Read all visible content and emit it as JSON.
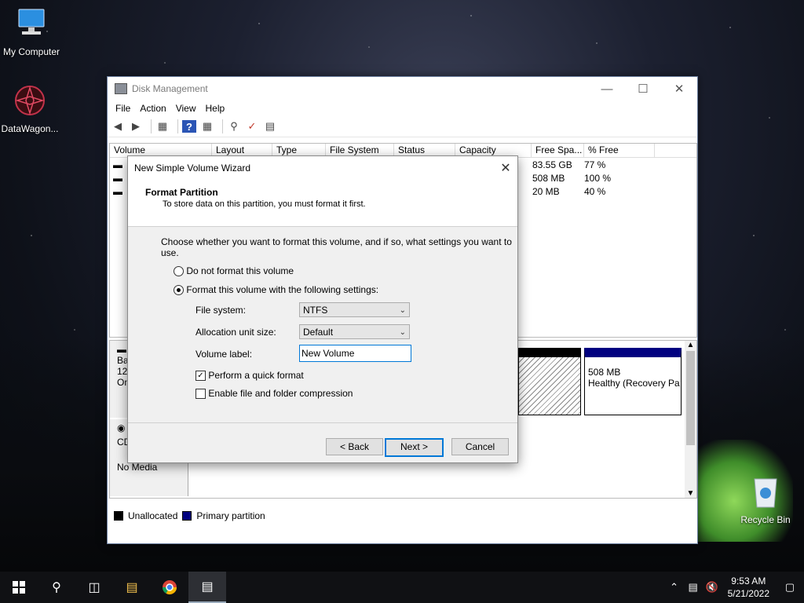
{
  "desktop": {
    "icons": [
      {
        "label": "My Computer",
        "icon": "computer-icon"
      },
      {
        "label": "DataWagon...",
        "icon": "datawagon-icon"
      },
      {
        "label": "Recycle Bin",
        "icon": "recycle-bin-icon"
      }
    ]
  },
  "window": {
    "title": "Disk Management",
    "menu": [
      "File",
      "Action",
      "View",
      "Help"
    ],
    "columns": [
      "Volume",
      "Layout",
      "Type",
      "File System",
      "Status",
      "Capacity",
      "Free Spa...",
      "% Free"
    ],
    "rows": [
      {
        "free": "83.55 GB",
        "pct": "77 %"
      },
      {
        "free": "508 MB",
        "pct": "100 %"
      },
      {
        "free": "20 MB",
        "pct": "40 %"
      }
    ],
    "disk_labels": [
      "Bas",
      "120",
      "On"
    ],
    "cd_label": "CD",
    "cd_status": "No Media",
    "partition_size": "508 MB",
    "partition_status": "Healthy (Recovery Pa",
    "legend": [
      "Unallocated",
      "Primary partition"
    ],
    "colors": {
      "unallocated": "#000000",
      "primary": "#000080"
    }
  },
  "dialog": {
    "title": "New Simple Volume Wizard",
    "heading": "Format Partition",
    "subheading": "To store data on this partition, you must format it first.",
    "instruction": "Choose whether you want to format this volume, and if so, what settings you want to use.",
    "radio_no_format": "Do not format this volume",
    "radio_format": "Format this volume with the following settings:",
    "fs_label": "File system:",
    "fs_value": "NTFS",
    "alloc_label": "Allocation unit size:",
    "alloc_value": "Default",
    "vol_label_label": "Volume label:",
    "vol_label_value": "New Volume",
    "quick_format": "Perform a quick format",
    "quick_format_checked": true,
    "compression": "Enable file and folder compression",
    "compression_checked": false,
    "btn_back": "< Back",
    "btn_next": "Next >",
    "btn_cancel": "Cancel"
  },
  "taskbar": {
    "time": "9:53 AM",
    "date": "5/21/2022"
  }
}
